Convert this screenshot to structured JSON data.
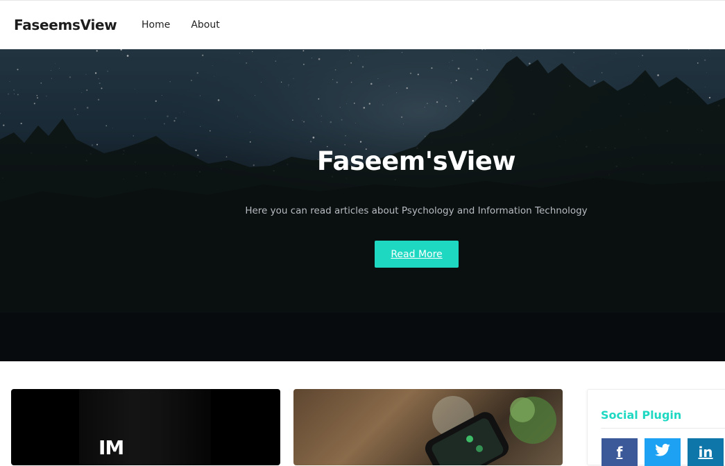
{
  "header": {
    "brand": "FaseemsView",
    "nav": [
      "Home",
      "About"
    ]
  },
  "hero": {
    "title": "Faseem'sView",
    "subtitle": "Here you can read articles about Psychology and Information Technology",
    "button_label": "Read More"
  },
  "posts": [
    {
      "cover_text": "IM"
    },
    {
      "cover_text": ""
    }
  ],
  "sidebar": {
    "widget_title": "Social Plugin",
    "social": [
      {
        "icon": "facebook-icon",
        "glyph": "f",
        "color": "#3b5998"
      },
      {
        "icon": "twitter-icon",
        "glyph": "t",
        "color": "#1da1f2"
      },
      {
        "icon": "linkedin-icon",
        "glyph": "in",
        "color": "#0e76a8"
      }
    ]
  },
  "colors": {
    "accent": "#1fd8c2",
    "text_dark": "#1d1d1d"
  }
}
